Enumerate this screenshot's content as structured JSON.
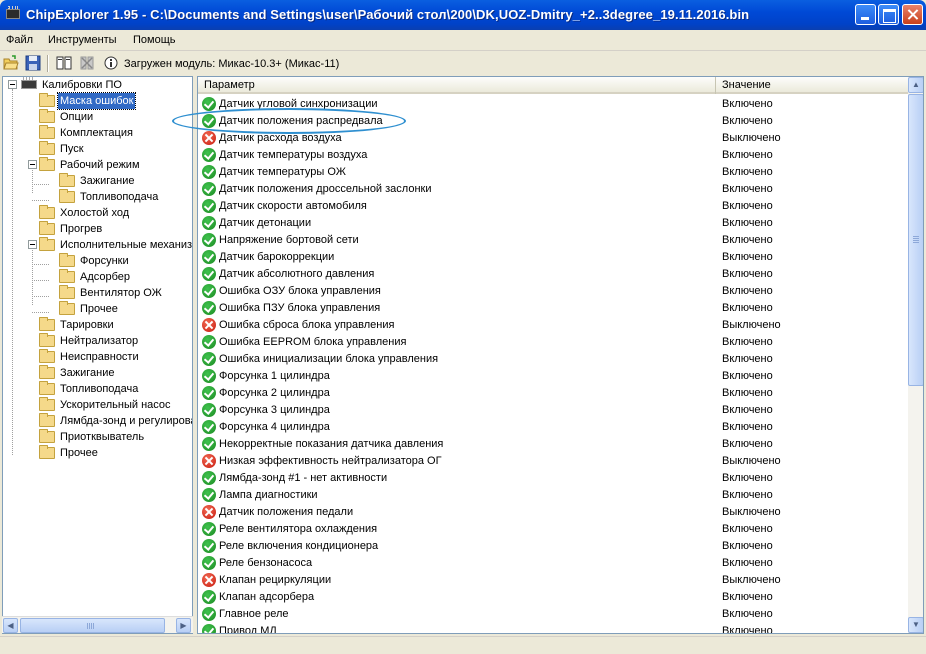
{
  "window": {
    "title": "ChipExplorer  1.95 - C:\\Documents and Settings\\user\\Рабочий стол\\200\\DK,UOZ-Dmitry_+2..3degree_19.11.2016.bin"
  },
  "menu": [
    "Файл",
    "Инструменты",
    "Помощь"
  ],
  "toolbar": {
    "module_text": "Загружен модуль: Микас-10.3+ (Микас-11)"
  },
  "tree": {
    "root": "Калибровки ПО",
    "items": [
      {
        "label": "Маска ошибок",
        "selected": true
      },
      {
        "label": "Опции"
      },
      {
        "label": "Комплектация"
      },
      {
        "label": "Пуск"
      },
      {
        "label": "Рабочий режим"
      },
      {
        "label": "Зажигание"
      },
      {
        "label": "Топливоподача"
      },
      {
        "label": "Холостой ход"
      },
      {
        "label": "Прогрев"
      },
      {
        "label": "Исполнительные механизмы"
      },
      {
        "label": "Форсунки"
      },
      {
        "label": "Адсорбер"
      },
      {
        "label": "Вентилятор ОЖ"
      },
      {
        "label": "Прочее"
      },
      {
        "label": "Тарировки"
      },
      {
        "label": "Нейтрализатор"
      },
      {
        "label": "Неисправности"
      },
      {
        "label": "Зажигание"
      },
      {
        "label": "Топливоподача"
      },
      {
        "label": "Ускорительный насос"
      },
      {
        "label": "Лямбда-зонд и регулирование"
      },
      {
        "label": "Приотквыватель"
      },
      {
        "label": "Прочее"
      }
    ]
  },
  "list": {
    "columns": [
      "Параметр",
      "Значение"
    ],
    "rows": [
      {
        "name": "Датчик угловой синхронизации",
        "value": "Включено",
        "status": "ok"
      },
      {
        "name": "Датчик положения распредвала",
        "value": "Включено",
        "status": "ok"
      },
      {
        "name": "Датчик расхода воздуха",
        "value": "Выключено",
        "status": "err"
      },
      {
        "name": "Датчик температуры воздуха",
        "value": "Включено",
        "status": "ok"
      },
      {
        "name": "Датчик температуры ОЖ",
        "value": "Включено",
        "status": "ok"
      },
      {
        "name": "Датчик положения дроссельной заслонки",
        "value": "Включено",
        "status": "ok"
      },
      {
        "name": "Датчик скорости автомобиля",
        "value": "Включено",
        "status": "ok"
      },
      {
        "name": "Датчик детонации",
        "value": "Включено",
        "status": "ok"
      },
      {
        "name": "Напряжение бортовой сети",
        "value": "Включено",
        "status": "ok"
      },
      {
        "name": "Датчик барокоррекции",
        "value": "Включено",
        "status": "ok"
      },
      {
        "name": "Датчик абсолютного давления",
        "value": "Включено",
        "status": "ok"
      },
      {
        "name": "Ошибка ОЗУ блока управления",
        "value": "Включено",
        "status": "ok"
      },
      {
        "name": "Ошибка ПЗУ блока управления",
        "value": "Включено",
        "status": "ok"
      },
      {
        "name": "Ошибка сброса блока управления",
        "value": "Выключено",
        "status": "err"
      },
      {
        "name": "Ошибка EEPROM блока управления",
        "value": "Включено",
        "status": "ok"
      },
      {
        "name": "Ошибка инициализации блока управления",
        "value": "Включено",
        "status": "ok"
      },
      {
        "name": "Форсунка 1 цилиндра",
        "value": "Включено",
        "status": "ok"
      },
      {
        "name": "Форсунка 2 цилиндра",
        "value": "Включено",
        "status": "ok"
      },
      {
        "name": "Форсунка 3 цилиндра",
        "value": "Включено",
        "status": "ok"
      },
      {
        "name": "Форсунка 4 цилиндра",
        "value": "Включено",
        "status": "ok"
      },
      {
        "name": "Некорректные показания датчика давления",
        "value": "Включено",
        "status": "ok"
      },
      {
        "name": "Низкая эффективность нейтрализатора ОГ",
        "value": "Выключено",
        "status": "err"
      },
      {
        "name": "Лямбда-зонд #1 - нет активности",
        "value": "Включено",
        "status": "ok"
      },
      {
        "name": "Лампа диагностики",
        "value": "Включено",
        "status": "ok"
      },
      {
        "name": "Датчик положения педали",
        "value": "Выключено",
        "status": "err"
      },
      {
        "name": "Реле вентилятора охлаждения",
        "value": "Включено",
        "status": "ok"
      },
      {
        "name": "Реле включения кондиционера",
        "value": "Включено",
        "status": "ok"
      },
      {
        "name": "Реле бензонасоса",
        "value": "Включено",
        "status": "ok"
      },
      {
        "name": "Клапан рециркуляции",
        "value": "Выключено",
        "status": "err"
      },
      {
        "name": "Клапан адсорбера",
        "value": "Включено",
        "status": "ok"
      },
      {
        "name": "Главное реле",
        "value": "Включено",
        "status": "ok"
      },
      {
        "name": "Привод МД",
        "value": "Включено",
        "status": "ok"
      }
    ]
  },
  "colors": {
    "titlebar": "#0049d6",
    "selection": "#316ac5",
    "ok": "#1c8a22",
    "error": "#c81a0e",
    "highlight_ellipse": "#2e8fd0"
  }
}
